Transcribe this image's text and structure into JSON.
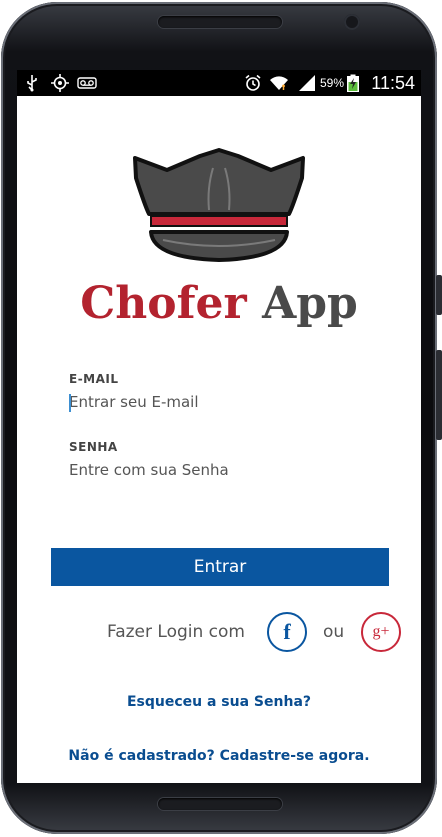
{
  "status_bar": {
    "icons_left": [
      "usb-icon",
      "gps-icon",
      "voicemail-icon"
    ],
    "icons_right": [
      "alarm-icon",
      "wifi-icon",
      "signal-icon",
      "battery-charging-icon"
    ],
    "battery_percent": "59%",
    "time": "11:54"
  },
  "brand": {
    "name_part1": "Chofer",
    "name_part2": "App",
    "logo_icon": "chauffeur-cap-icon",
    "primary_color": "#b3232f",
    "secondary_color": "#4a4a4a"
  },
  "form": {
    "email_label": "E-MAIL",
    "email_placeholder": "Entrar seu E-mail",
    "email_value": "",
    "password_label": "SENHA",
    "password_placeholder": "Entre com sua Senha",
    "password_value": "",
    "submit_label": "Entrar"
  },
  "social": {
    "label": "Fazer Login com",
    "facebook_glyph": "f",
    "or_label": "ou",
    "google_glyph": "g+"
  },
  "links": {
    "forgot_password": "Esqueceu a sua Senha?",
    "register": "Não é cadastrado? Cadastre-se agora."
  },
  "colors": {
    "button": "#0a56a0",
    "link": "#0a4d90",
    "google": "#c8283a"
  }
}
